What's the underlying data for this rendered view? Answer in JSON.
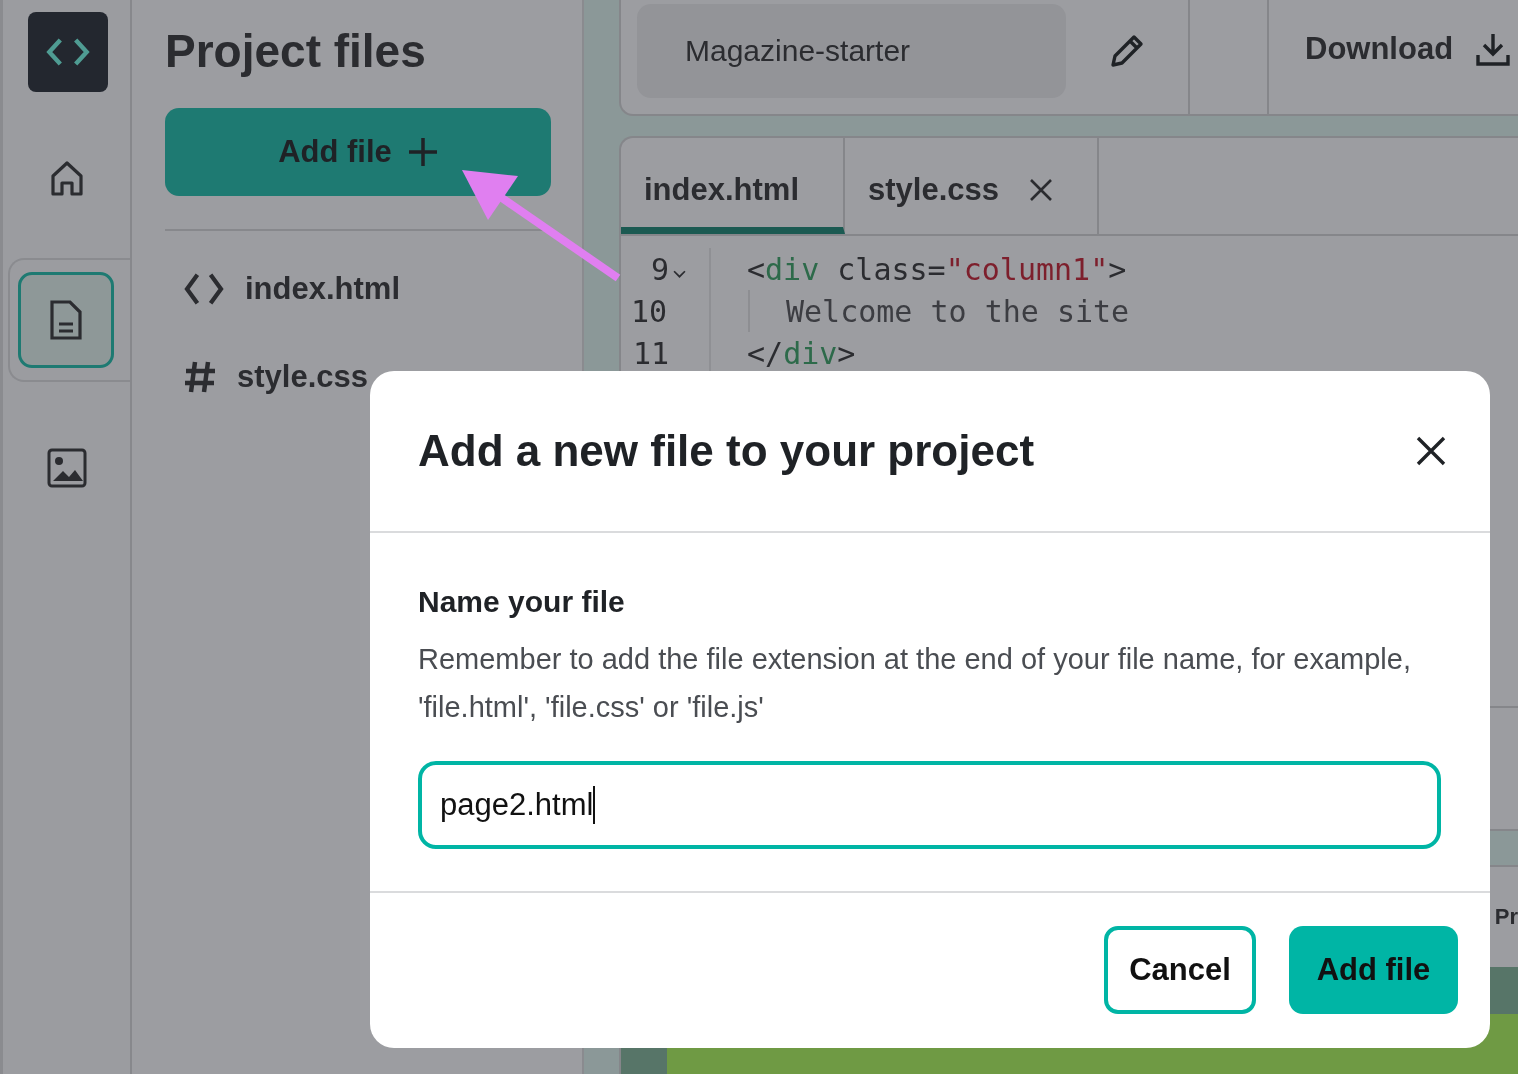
{
  "rail": {
    "items": [
      {
        "kind": "home",
        "selected": false
      },
      {
        "kind": "files",
        "selected": true
      },
      {
        "kind": "images",
        "selected": false
      }
    ]
  },
  "files_panel": {
    "title": "Project files",
    "add_button": "Add file",
    "files": [
      {
        "kind": "html",
        "name": "index.html"
      },
      {
        "kind": "css",
        "name": "style.css"
      }
    ]
  },
  "header": {
    "project_name": "Magazine-starter",
    "download": "Download"
  },
  "editor": {
    "tabs": [
      {
        "label": "index.html",
        "selected": true,
        "closable": false
      },
      {
        "label": "style.css",
        "selected": false,
        "closable": true
      }
    ],
    "lines": [
      {
        "number": "9",
        "foldable": true,
        "tokens": [
          {
            "kind": "punct",
            "text": "<"
          },
          {
            "kind": "tag",
            "text": "div"
          },
          {
            "kind": "attr",
            "text": " class="
          },
          {
            "kind": "string",
            "text": "\"column1\""
          },
          {
            "kind": "punct",
            "text": ">"
          }
        ],
        "children": [
          {
            "number": "10",
            "foldable": false,
            "tokens": [
              {
                "kind": "text",
                "text": "Welcome to the site"
              }
            ]
          }
        ]
      },
      {
        "number": "11",
        "foldable": false,
        "tokens": [
          {
            "kind": "punct",
            "text": "</"
          },
          {
            "kind": "tag",
            "text": "div"
          },
          {
            "kind": "punct",
            "text": ">"
          }
        ]
      }
    ]
  },
  "preview": {
    "heading": "Pr"
  },
  "modal": {
    "title": "Add a new file to your project",
    "label": "Name your file",
    "help": "Remember to add the file extension at the end of your file name, for example, 'file.html', 'file.css' or 'file.js'",
    "value": "page2.html",
    "cancel": "Cancel",
    "confirm": "Add file"
  }
}
